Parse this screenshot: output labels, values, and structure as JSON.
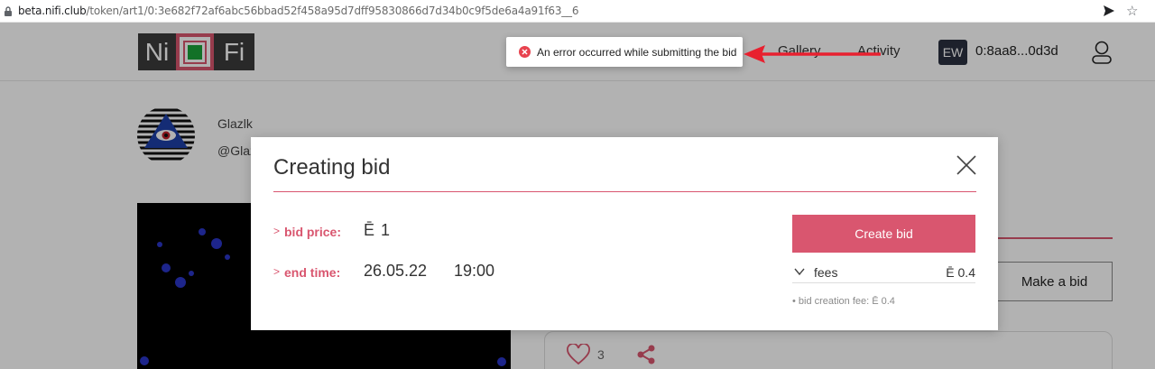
{
  "browser": {
    "url_host": "beta.nifi.club",
    "url_path": "/token/art1/0:3e682f72af6abc56bbad52f458a95d7dff95830866d7d34b0c9f5de6a4a91f63__6"
  },
  "header": {
    "logo_left": "Ni",
    "logo_right": "Fi",
    "nav": [
      "Gallery",
      "Activity"
    ],
    "wallet_badge": "EW",
    "wallet_address": "0:8aa8...0d3d"
  },
  "creator": {
    "name": "Glazlk",
    "handle": "@Glaz"
  },
  "bid_panel": {
    "make_bid_label": "Make a bid",
    "likes_count": "3"
  },
  "modal": {
    "title": "Creating bid",
    "bid_price_label": "bid price:",
    "currency_symbol": "Ē",
    "bid_price_value": "1",
    "end_time_label": "end time:",
    "end_date": "26.05.22",
    "end_time": "19:00",
    "create_button": "Create bid",
    "fees_label": "fees",
    "fees_value": "Ē 0.4",
    "fees_note": "• bid creation fee: Ē 0.4"
  },
  "toast": {
    "message": "An error occurred while submitting the bid"
  },
  "colors": {
    "accent": "#d9566f",
    "error": "#e8434f",
    "arrow": "#e8202f"
  }
}
